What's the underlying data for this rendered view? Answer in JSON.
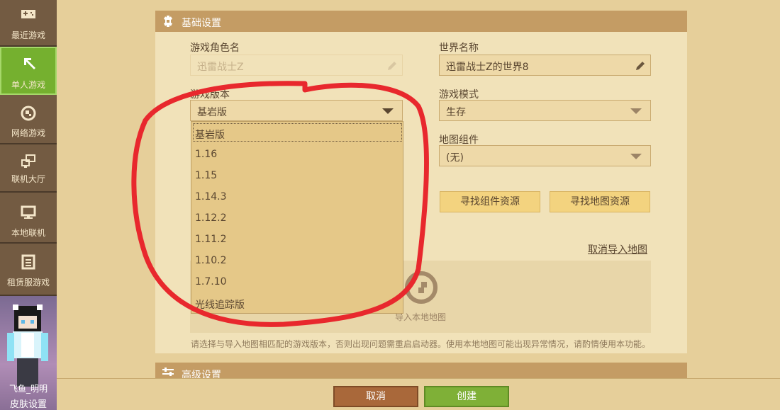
{
  "sidebar": {
    "items": [
      {
        "label": "最近游戏",
        "icon": "gamepad-icon"
      },
      {
        "label": "单人游戏",
        "icon": "pickaxe-icon",
        "active": true
      },
      {
        "label": "网络游戏",
        "icon": "globe-icon"
      },
      {
        "label": "联机大厅",
        "icon": "network-icon"
      },
      {
        "label": "本地联机",
        "icon": "monitor-icon"
      },
      {
        "label": "租赁服游戏",
        "icon": "server-icon"
      }
    ],
    "skin_name": "飞鱼_明明",
    "skin_settings": "皮肤设置"
  },
  "basic": {
    "title": "基础设置",
    "role_label": "游戏角色名",
    "role_value": "迅雷战士Z",
    "world_label": "世界名称",
    "world_value": "迅雷战士Z的世界8",
    "version_label": "游戏版本",
    "version_value": "基岩版",
    "mode_label": "游戏模式",
    "mode_value": "生存",
    "component_label": "地图组件",
    "component_value": "(无)",
    "find_component_btn": "寻找组件资源",
    "find_map_btn": "寻找地图资源",
    "cancel_import_link": "取消导入地图",
    "import_label": "导入本地地图",
    "hint": "请选择与导入地图相匹配的游戏版本，否则出现问题需重启启动器。使用本地地图可能出现异常情况，请酌情使用本功能。"
  },
  "version_options": [
    "基岩版",
    "1.16",
    "1.15",
    "1.14.3",
    "1.12.2",
    "1.11.2",
    "1.10.2",
    "1.7.10",
    "光线追踪版"
  ],
  "advanced": {
    "title": "高级设置"
  },
  "footer": {
    "cancel": "取消",
    "create": "创建"
  },
  "colors": {
    "accent_green": "#7fb037",
    "cancel_brown": "#a9683a",
    "annotation_red": "#e8282d"
  }
}
